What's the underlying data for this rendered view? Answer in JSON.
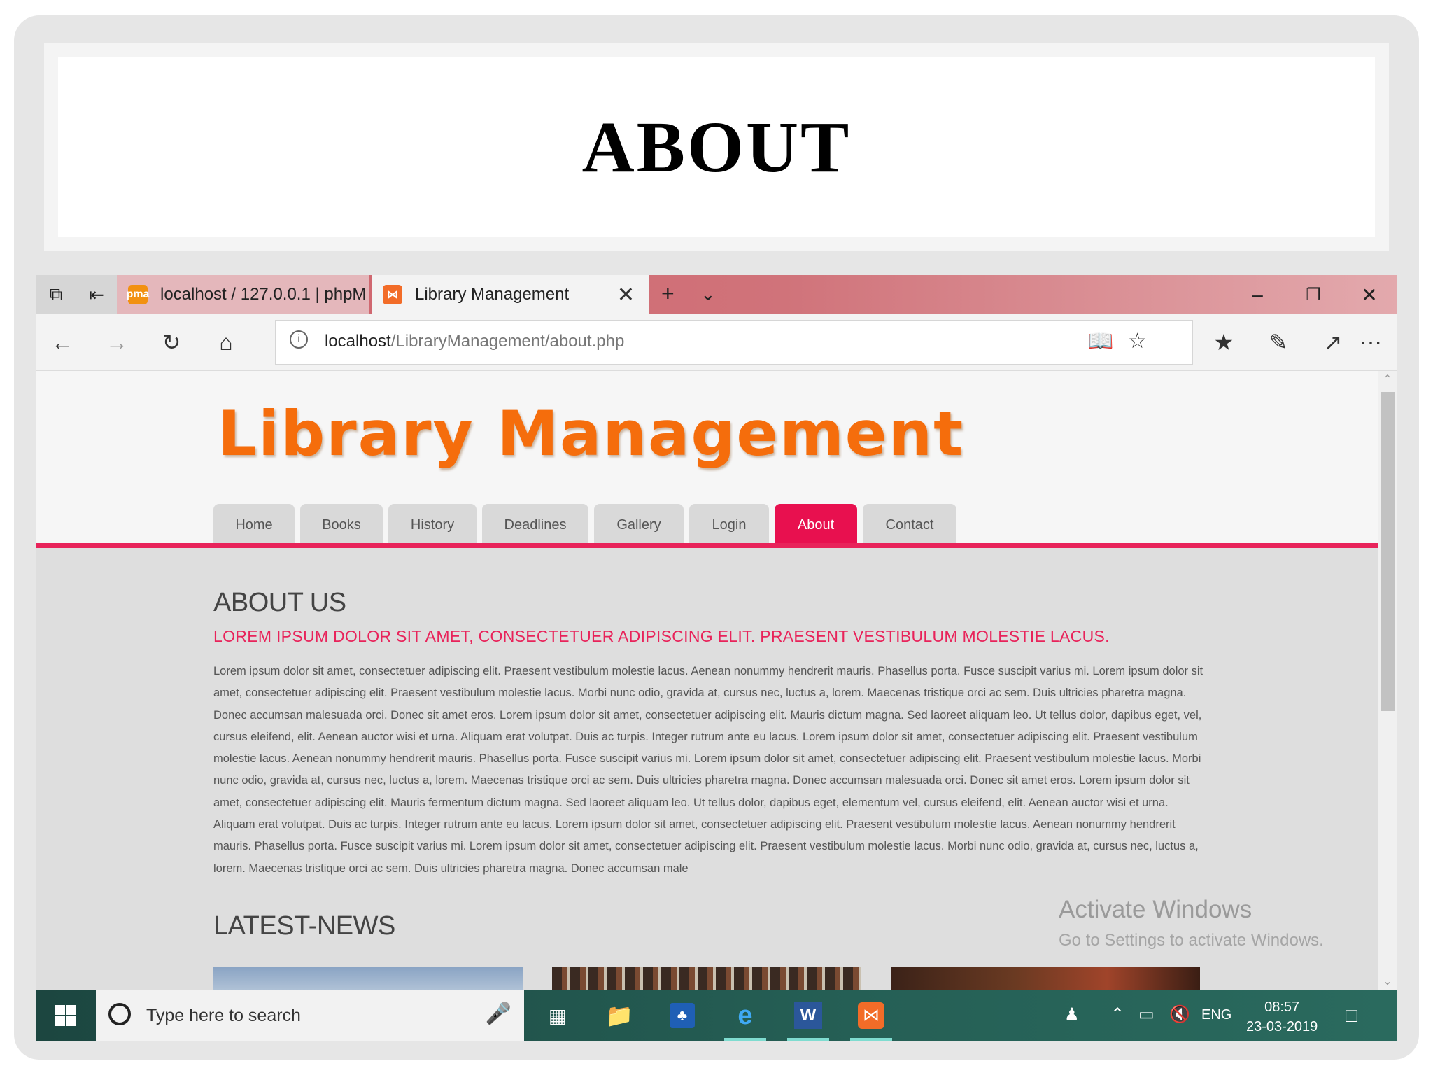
{
  "slide": {
    "title": "ABOUT"
  },
  "browser": {
    "tabs": [
      {
        "label": "localhost / 127.0.0.1 | phpM",
        "active": false,
        "favicon": "phpmyadmin-icon"
      },
      {
        "label": "Library Management",
        "active": true,
        "favicon": "xampp-icon"
      }
    ],
    "address": {
      "host": "localhost",
      "path": "/LibraryManagement/about.php"
    },
    "accent_color": "#cf5f69"
  },
  "site": {
    "title": "Library Management",
    "title_color": "#f56d0c",
    "menu": [
      {
        "label": "Home",
        "active": false
      },
      {
        "label": "Books",
        "active": false
      },
      {
        "label": "History",
        "active": false
      },
      {
        "label": "Deadlines",
        "active": false
      },
      {
        "label": "Gallery",
        "active": false
      },
      {
        "label": "Login",
        "active": false
      },
      {
        "label": "About",
        "active": true
      },
      {
        "label": "Contact",
        "active": false
      }
    ],
    "menu_active_color": "#e8104f"
  },
  "about": {
    "heading": "ABOUT US",
    "subheading": "LOREM IPSUM DOLOR SIT AMET, CONSECTETUER ADIPISCING ELIT. PRAESENT VESTIBULUM MOLESTIE LACUS.",
    "body": "Lorem ipsum dolor sit amet, consectetuer adipiscing elit. Praesent vestibulum molestie lacus. Aenean nonummy hendrerit mauris. Phasellus porta. Fusce suscipit varius mi. Lorem ipsum dolor sit amet, consectetuer adipiscing elit. Praesent vestibulum molestie lacus. Morbi nunc odio, gravida at, cursus nec, luctus a, lorem. Maecenas tristique orci ac sem. Duis ultricies pharetra magna. Donec accumsan malesuada orci. Donec sit amet eros. Lorem ipsum dolor sit amet, consectetuer adipiscing elit. Mauris dictum magna. Sed laoreet aliquam leo. Ut tellus dolor, dapibus eget, vel, cursus eleifend, elit. Aenean auctor wisi et urna. Aliquam erat volutpat. Duis ac turpis. Integer rutrum ante eu lacus. Lorem ipsum dolor sit amet, consectetuer adipiscing elit. Praesent vestibulum molestie lacus. Aenean nonummy hendrerit mauris. Phasellus porta. Fusce suscipit varius mi. Lorem ipsum dolor sit amet, consectetuer adipiscing elit. Praesent vestibulum molestie lacus. Morbi nunc odio, gravida at, cursus nec, luctus a, lorem. Maecenas tristique orci ac sem. Duis ultricies pharetra magna. Donec accumsan malesuada orci. Donec sit amet eros. Lorem ipsum dolor sit amet, consectetuer adipiscing elit. Mauris fermentum dictum magna. Sed laoreet aliquam leo. Ut tellus dolor, dapibus eget, elementum vel, cursus eleifend, elit. Aenean auctor wisi et urna. Aliquam erat volutpat. Duis ac turpis. Integer rutrum ante eu lacus. Lorem ipsum dolor sit amet, consectetuer adipiscing elit. Praesent vestibulum molestie lacus. Aenean nonummy hendrerit mauris. Phasellus porta. Fusce suscipit varius mi. Lorem ipsum dolor sit amet, consectetuer adipiscing elit. Praesent vestibulum molestie lacus. Morbi nunc odio, gravida at, cursus nec, luctus a, lorem. Maecenas tristique orci ac sem. Duis ultricies pharetra magna. Donec accumsan male",
    "subheading_color": "#e8235a"
  },
  "news": {
    "heading": "LATEST-NEWS"
  },
  "watermark": {
    "title": "Activate Windows",
    "subtitle": "Go to Settings to activate Windows."
  },
  "taskbar": {
    "search_placeholder": "Type here to search",
    "language": "ENG",
    "time": "08:57",
    "date": "23-03-2019"
  }
}
